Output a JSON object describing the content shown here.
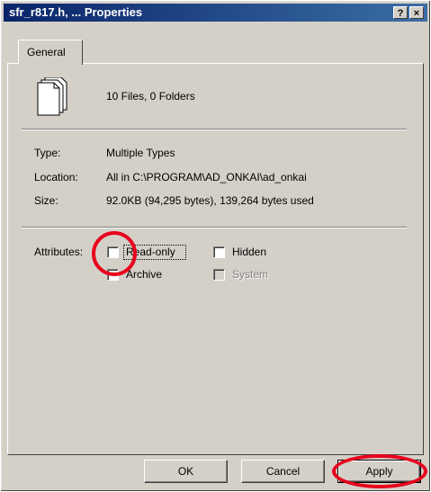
{
  "window": {
    "title": "sfr_r817.h, ... Properties",
    "help_button": "?",
    "close_button": "×"
  },
  "tabs": [
    {
      "label": "General",
      "selected": true
    }
  ],
  "summary": {
    "icon": "multiple-files-icon",
    "text": "10 Files, 0 Folders"
  },
  "properties": [
    {
      "label": "Type:",
      "value": "Multiple Types"
    },
    {
      "label": "Location:",
      "value": "All in C:\\PROGRAM\\AD_ONKAI\\ad_onkai"
    },
    {
      "label": "Size:",
      "value": "92.0KB (94,295 bytes), 139,264 bytes used"
    }
  ],
  "attributes": {
    "label": "Attributes:",
    "read_only": {
      "label": "Read-only",
      "checked": false,
      "enabled": true
    },
    "hidden": {
      "label": "Hidden",
      "checked": false,
      "enabled": true
    },
    "archive": {
      "label": "Archive",
      "checked": false,
      "enabled": true
    },
    "system": {
      "label": "System",
      "checked": false,
      "enabled": false
    }
  },
  "buttons": {
    "ok": "OK",
    "cancel": "Cancel",
    "apply": "Apply"
  },
  "annotation_color": "#e8001c"
}
